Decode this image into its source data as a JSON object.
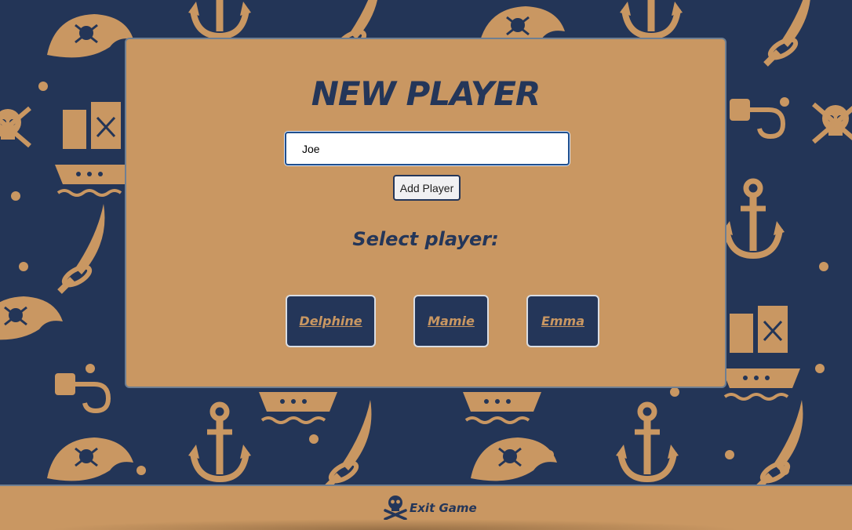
{
  "colors": {
    "background": "#233557",
    "panel": "#c99762",
    "accent_navy": "#243659",
    "pattern": "#c99762"
  },
  "new_player": {
    "title": "NEW PLAYER",
    "input_value": "Joe",
    "add_button_label": "Add Player"
  },
  "select": {
    "heading": "Select player:",
    "players": [
      "Delphine",
      "Mamie",
      "Emma"
    ]
  },
  "footer": {
    "exit_label": "Exit Game",
    "exit_icon": "skull-crossbones-icon"
  },
  "background_icons": [
    "anchor-icon",
    "sword-icon",
    "pirate-hat-icon",
    "pirate-ship-icon",
    "hook-icon",
    "skull-icon",
    "bottle-icon"
  ]
}
